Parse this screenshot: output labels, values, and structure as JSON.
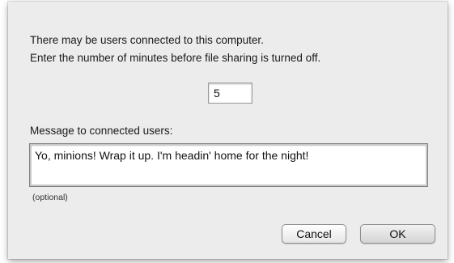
{
  "dialog": {
    "message_line1": "There may be users connected to this computer.",
    "message_line2": "Enter the number of minutes before file sharing is turned off.",
    "minutes_value": "5",
    "message_label": "Message to connected users:",
    "message_value": "Yo, minions! Wrap it up. I'm headin' home for the night!",
    "optional_note": "(optional)",
    "cancel_label": "Cancel",
    "ok_label": "OK"
  }
}
